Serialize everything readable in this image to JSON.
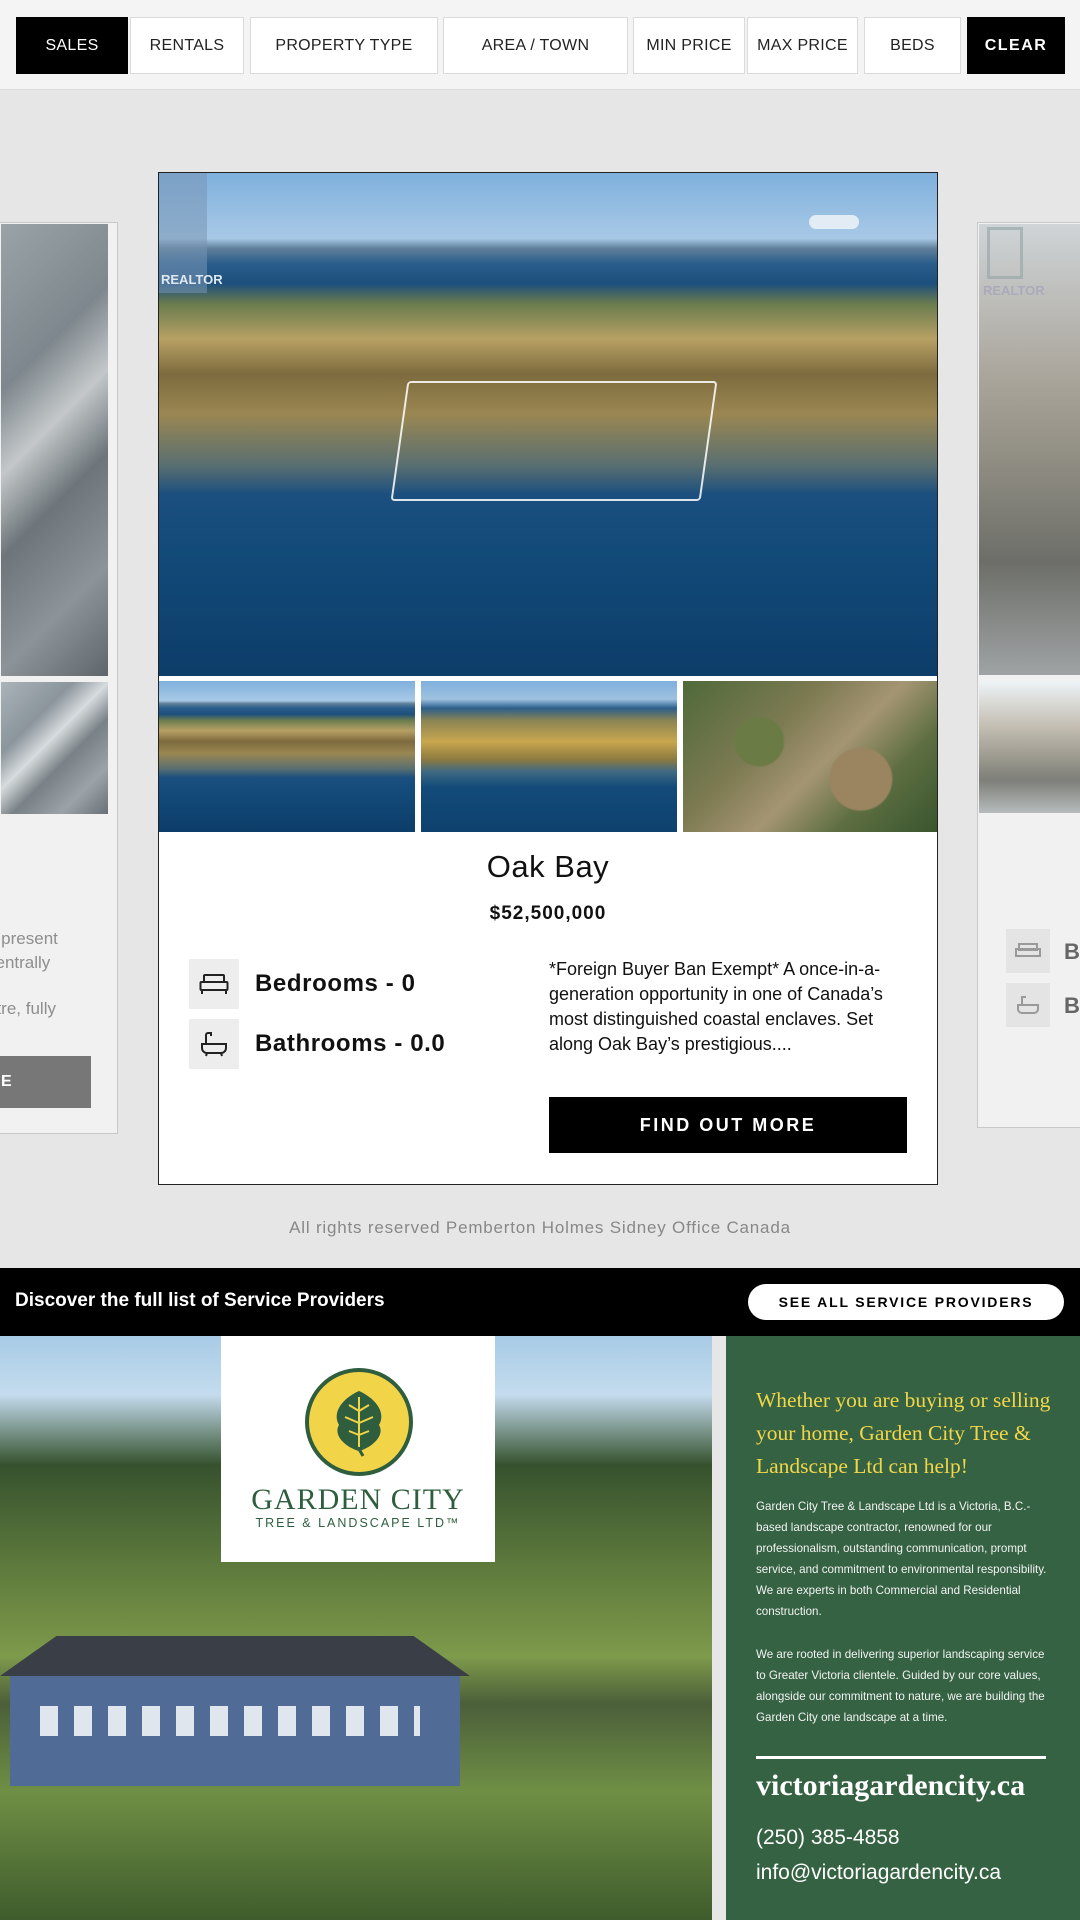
{
  "filters": {
    "sales": "SALES",
    "rentals": "RENTALS",
    "property_type": "PROPERTY TYPE",
    "area_town": "AREA / TOWN",
    "min_price": "MIN PRICE",
    "max_price": "MAX PRICE",
    "beds": "BEDS",
    "clear": "CLEAR"
  },
  "left_card": {
    "text_line1": "o present",
    "text_line2": "centrally",
    "text_line3": "ntre, fully",
    "button_partial": "E"
  },
  "right_card": {
    "bed_partial": "B",
    "bath_partial": "B"
  },
  "realtor_mark": "REALTOR",
  "listing": {
    "title": "Oak Bay",
    "price": "$52,500,000",
    "bedrooms": "Bedrooms - 0",
    "bathrooms": "Bathrooms - 0.0",
    "description": "*Foreign Buyer Ban Exempt* A once-in-a-generation opportunity in one of Canada’s most distinguished coastal enclaves. Set along Oak Bay’s prestigious....",
    "cta": "FIND OUT MORE"
  },
  "footer_note": "All rights reserved Pemberton Holmes Sidney Office Canada",
  "service_bar": {
    "text": "Discover the full list of Service Providers",
    "button": "SEE ALL SERVICE PROVIDERS"
  },
  "ad": {
    "logo_name": "GARDEN CITY",
    "logo_sub": "TREE & LANDSCAPE LTD™",
    "headline": "Whether you are buying or selling your home, Garden City Tree & Landscape Ltd can help!",
    "para1": "Garden City Tree & Landscape Ltd is a Victoria, B.C.-based landscape contractor, renowned for our professionalism, outstanding communication, prompt service, and commitment to environmental responsibility. We are experts in both Commercial and Residential construction.",
    "para2": "We are rooted in delivering superior landscaping service to Greater Victoria clientele. Guided by our core values, alongside our commitment to nature, we are building the Garden City one landscape at a time.",
    "url": "victoriagardencity.ca",
    "phone": "(250) 385-4858",
    "email": "info@victoriagardencity.ca",
    "colors": {
      "panel": "#356242",
      "headline": "#f1d64a",
      "logo_yellow": "#f2d449"
    }
  }
}
